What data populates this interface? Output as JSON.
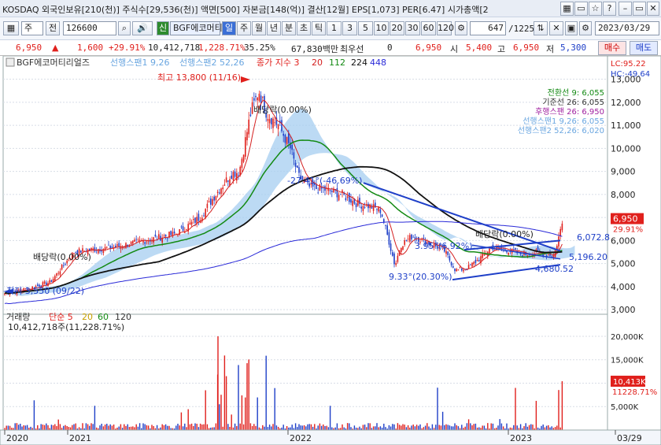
{
  "toolbar1": {
    "text": "KOSDAQ 외국인보유[210(천)] 주식수[29,536(천)] 액면[500] 자본금[148(억)] 결산[12월] EPS[1,073] PER[6.47] 시가총액[2",
    "icons": [
      "grid-icon",
      "window-icon",
      "star-icon",
      "help-icon",
      "minimize-icon",
      "restore-icon",
      "close-icon"
    ]
  },
  "toolbar2": {
    "market": "주",
    "prev_label": "전",
    "code": "126600",
    "shin": "신",
    "name": "BGF에코머티",
    "periods": [
      "일",
      "주",
      "월",
      "년",
      "분",
      "초",
      "틱"
    ],
    "minutes": [
      "1",
      "3",
      "5",
      "10",
      "20",
      "30",
      "60",
      "120"
    ],
    "count": "647",
    "total": "/1225",
    "date": "2023/03/29"
  },
  "quote": {
    "price": "6,950",
    "arrow": "▲",
    "change": "1,600",
    "pct": "+29.91%",
    "volume": "10,412,718",
    "vol_pct": "1,228.71%",
    "turnover": "35.25%",
    "amount": "67,830백만",
    "pref_label": "최우선",
    "pref_value": "0",
    "ask_price": "6,950",
    "open_label": "시",
    "open": "5,400",
    "high_label": "고",
    "high": "6,950",
    "low_label": "저",
    "low": "5,300",
    "buy": "매수",
    "sell": "매도"
  },
  "chart_data": {
    "type": "candlestick",
    "title": "BGF에코머티리얼즈",
    "legend_line": [
      "선행스팬1 9,26",
      "선행스팬2 52,26",
      "종가 지수 3",
      "20",
      "112",
      "224",
      "448"
    ],
    "y_ticks": [
      "13,000",
      "12,000",
      "11,000",
      "10,000",
      "9,000",
      "8,000",
      "7,000",
      "6,000",
      "5,000",
      "4,000",
      "3,000"
    ],
    "ylim": [
      2800,
      13600
    ],
    "x_ticks": [
      "2020",
      "2021",
      "2022",
      "2023",
      "03/29"
    ],
    "right_info": {
      "lc": "LC:95.22",
      "hc": "HC:-49.64",
      "last": "6,950",
      "pct": "29.91%"
    },
    "ichimoku_legend": [
      "전환선 9: 6,055",
      "기준선 26: 6,055",
      "후행스팬 26: 6,950",
      "선행스팬1 9,26: 6,055",
      "선행스팬2 52,26: 6,020"
    ],
    "annotations": {
      "high": "최고 13,800 (11/16)",
      "low": "최저 3,550 (09/22)",
      "div1": "배당락(0.00%)",
      "div2": "배당락(0.00%)",
      "div3": "배당락(0.00%)",
      "t1": "-27.41°(-46.69%)",
      "t2": "3.95°(6.92%)",
      "t3": "9.33°(20.30%)",
      "p1": "6,072.8",
      "p2": "5,196.20",
      "p3": "4,680.52"
    },
    "close_path": [
      [
        0,
        3700
      ],
      [
        30,
        3900
      ],
      [
        60,
        4200
      ],
      [
        90,
        5500
      ],
      [
        110,
        5600
      ],
      [
        140,
        5700
      ],
      [
        180,
        6000
      ],
      [
        220,
        6300
      ],
      [
        250,
        7000
      ],
      [
        270,
        8000
      ],
      [
        290,
        8900
      ],
      [
        300,
        9000
      ],
      [
        315,
        11600
      ],
      [
        325,
        12500
      ],
      [
        335,
        11500
      ],
      [
        350,
        11000
      ],
      [
        365,
        10000
      ],
      [
        375,
        8800
      ],
      [
        390,
        8300
      ],
      [
        410,
        8200
      ],
      [
        430,
        8000
      ],
      [
        450,
        7600
      ],
      [
        465,
        7500
      ],
      [
        480,
        7300
      ],
      [
        490,
        6000
      ],
      [
        498,
        4900
      ],
      [
        505,
        5800
      ],
      [
        520,
        6200
      ],
      [
        540,
        5900
      ],
      [
        560,
        5600
      ],
      [
        575,
        4700
      ],
      [
        590,
        4800
      ],
      [
        605,
        5200
      ],
      [
        620,
        5700
      ],
      [
        640,
        5600
      ],
      [
        660,
        5400
      ],
      [
        680,
        5500
      ],
      [
        700,
        5350
      ],
      [
        712,
        6950
      ]
    ],
    "volume": {
      "title": "거래량",
      "legend": [
        "단순 5",
        "20",
        "60",
        "120"
      ],
      "last": "10,412,718주(11,228.71%)",
      "y_ticks": [
        "20,000K",
        "15,000K",
        "10,000K",
        "5,000K"
      ],
      "ylim": [
        0,
        21000
      ],
      "right_info": {
        "last": "10,413K",
        "pct": "11228.71%"
      }
    },
    "colors": {
      "up": "#e0201c",
      "down": "#1e3fc8",
      "ma20": "#d42020",
      "ma112": "#138a13",
      "ma224": "#111111",
      "ma448": "#2a2ad8",
      "cloud": "#a6cdf0"
    }
  }
}
